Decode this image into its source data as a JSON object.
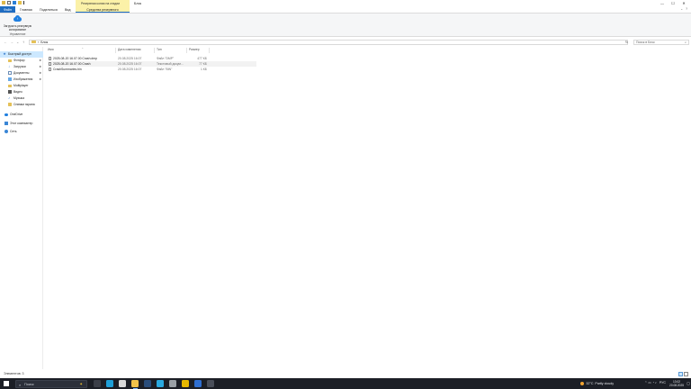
{
  "titlebar": {
    "context_group": "Резервная копия на стадии",
    "window_title": "Блок",
    "controls": [
      "—",
      "☐",
      "✕"
    ]
  },
  "tabs": {
    "file": "Файл",
    "home": "Главная",
    "share": "Поделиться",
    "view": "Вид",
    "context": "Средства резервного копирования"
  },
  "ribbon": {
    "command_label": "Загрузить резервную копирование",
    "group_label": "Управление",
    "right_icons": [
      "⌄",
      "?"
    ]
  },
  "addressbar": {
    "back": "←",
    "forward": "→",
    "recent": "⌄",
    "up": "↑",
    "path_sep": "›",
    "path": "Блок",
    "dropdown": "⌄",
    "refresh": "↻",
    "search_placeholder": "Поиск в Блок",
    "search_icon": "⌕"
  },
  "nav": {
    "quick_access": "Быстрый доступ",
    "items": [
      {
        "label": "Фотфор",
        "icon": "folder-icon",
        "pinned": true
      },
      {
        "label": "Загрузки",
        "icon": "download-icon",
        "pinned": true
      },
      {
        "label": "Документы",
        "icon": "document-icon",
        "pinned": true
      },
      {
        "label": "Изображения",
        "icon": "image-icon",
        "pinned": true
      },
      {
        "label": "Multiplayer",
        "icon": "folder-icon",
        "pinned": false
      },
      {
        "label": "Видео",
        "icon": "video-icon",
        "pinned": false
      },
      {
        "label": "Музыка",
        "icon": "music-icon",
        "pinned": false
      },
      {
        "label": "Снимки экрана",
        "icon": "folder-icon",
        "pinned": false
      }
    ],
    "onedrive": "OneDrive",
    "this_pc": "Этот компьютер",
    "network": "Сеть",
    "pin_glyph": "✱"
  },
  "columns": {
    "name": "Имя",
    "date": "Дата изменения",
    "type": "Тип",
    "size": "Размер",
    "sort_glyph": "^"
  },
  "files": [
    {
      "name": "2025-08-20 16.07.00 Crash.dmp",
      "date": "20.08.2025 16:07",
      "type": "Файл \"DMP\"",
      "size": "477 КБ"
    },
    {
      "name": "2025-08-20 16.07.00 Crash",
      "date": "20.08.2025 16:07",
      "type": "Текстовый докум...",
      "size": "77 КБ"
    },
    {
      "name": "CrashSummaries.bin",
      "date": "20.08.2025 16:07",
      "type": "Файл \"BIN\"",
      "size": "1 КБ"
    }
  ],
  "status": {
    "count": "Элементов: 3"
  },
  "taskbar": {
    "search_label": "Поиск",
    "search_icon": "⌕",
    "search_deco": "✦",
    "apps": [
      {
        "name": "task-view",
        "color": "#3b3f48"
      },
      {
        "name": "edge",
        "color": "#1f9fd8"
      },
      {
        "name": "chrome",
        "color": "#d9d9d9"
      },
      {
        "name": "file-explorer",
        "color": "#f0c24a"
      },
      {
        "name": "steam",
        "color": "#2a4d7a"
      },
      {
        "name": "edge-dev",
        "color": "#2aa9e0"
      },
      {
        "name": "terminal",
        "color": "#9aa0a6"
      },
      {
        "name": "chrome-beta",
        "color": "#e6b800"
      },
      {
        "name": "app-window",
        "color": "#2f6fd1"
      },
      {
        "name": "app-misc",
        "color": "#4a4f5a"
      }
    ],
    "weather_temp": "32°C",
    "weather_text": "Partly cloudy",
    "tray_icons": "⌃ ▭ ◔ ♪",
    "lang": "РУС",
    "time": "13:02",
    "date": "20.08.2025",
    "notif": "▢"
  },
  "colors": {
    "accent": "#1f6cc1",
    "context_tab": "#fbf1a8",
    "selection": "#cce8ff",
    "taskbar": "#1c1f26"
  }
}
